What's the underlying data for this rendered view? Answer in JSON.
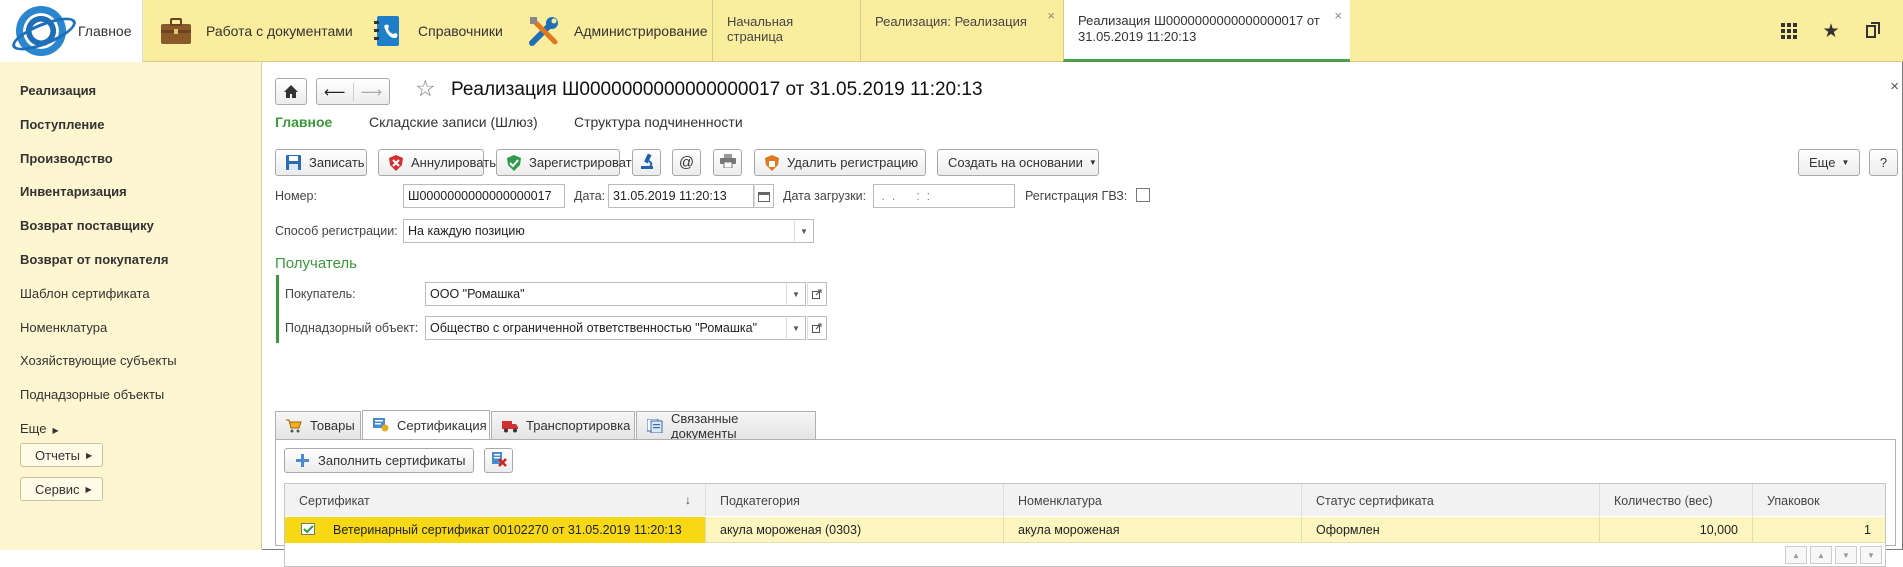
{
  "topbar": {
    "home_label": "Главное",
    "sections": [
      {
        "label": "Работа с документами",
        "icon": "briefcase-icon"
      },
      {
        "label": "Справочники",
        "icon": "phonebook-icon"
      },
      {
        "label": "Администрирование",
        "icon": "tools-icon"
      }
    ],
    "tabs": [
      {
        "label": "Начальная страница"
      },
      {
        "label": "Реализация: Реализация",
        "close": "×"
      },
      {
        "line1": "Реализация Ш0000000000000000017 от",
        "line2": "31.05.2019 11:20:13",
        "close": "×"
      }
    ],
    "icons": [
      "grid-icon",
      "star-icon",
      "history-icon"
    ]
  },
  "sidebar": {
    "items": [
      {
        "label": "Реализация",
        "bold": true
      },
      {
        "label": "Поступление",
        "bold": true
      },
      {
        "label": "Производство",
        "bold": true
      },
      {
        "label": "Инвентаризация",
        "bold": true
      },
      {
        "label": "Возврат поставщику",
        "bold": true
      },
      {
        "label": "Возврат от покупателя",
        "bold": true
      },
      {
        "label": "Шаблон сертификата",
        "bold": false
      },
      {
        "label": "Номенклатура",
        "bold": false
      },
      {
        "label": "Хозяйствующие субъекты",
        "bold": false
      },
      {
        "label": "Поднадзорные объекты",
        "bold": false
      }
    ],
    "more_label": "Еще",
    "reports_label": "Отчеты",
    "service_label": "Сервис"
  },
  "form": {
    "title": "Реализация Ш0000000000000000017 от 31.05.2019 11:20:13",
    "close_symbol": "×",
    "tabs": [
      "Главное",
      "Складские записи (Шлюз)",
      "Структура подчиненности"
    ],
    "toolbar": {
      "save": "Записать",
      "annul": "Аннулировать",
      "register": "Зарегистрировать",
      "at": "@",
      "delete_reg": "Удалить регистрацию",
      "create_based": "Создать на основании",
      "more": "Еще",
      "help": "?"
    },
    "number_label": "Номер:",
    "number_value": "Ш0000000000000000017",
    "date_label": "Дата:",
    "date_value": "31.05.2019 11:20:13",
    "load_date_label": "Дата загрузки:",
    "load_date_value": " .  .      :  :",
    "gvz_label": "Регистрация ГВЗ:",
    "reg_method_label": "Способ регистрации:",
    "reg_method_value": "На каждую позицию",
    "recipient_header": "Получатель",
    "buyer_label": "Покупатель:",
    "buyer_value": "ООО \"Ромашка\"",
    "object_label": "Поднадзорный объект:",
    "object_value": "Общество с ограниченной ответственностью  \"Ромашка\""
  },
  "page_tabs": [
    {
      "label": "Товары",
      "icon": "cart-icon"
    },
    {
      "label": "Сертификация",
      "icon": "certificate-icon"
    },
    {
      "label": "Транспортировка",
      "icon": "truck-icon"
    },
    {
      "label": "Связанные документы",
      "icon": "documents-icon"
    }
  ],
  "panel": {
    "fill_label": "Заполнить сертификаты"
  },
  "table": {
    "columns": [
      "Сертификат",
      "Подкатегория",
      "Номенклатура",
      "Статус сертификата",
      "Количество (вес)",
      "Упаковок"
    ],
    "sort_arrow": "↓",
    "rows": [
      {
        "certificate": "Ветеринарный сертификат 00102270 от 31.05.2019 11:20:13",
        "subcategory": "акула мороженая (0303)",
        "nomenclature": "акула мороженая",
        "status": "Оформлен",
        "quantity": "10,000",
        "packs": "1"
      }
    ]
  }
}
